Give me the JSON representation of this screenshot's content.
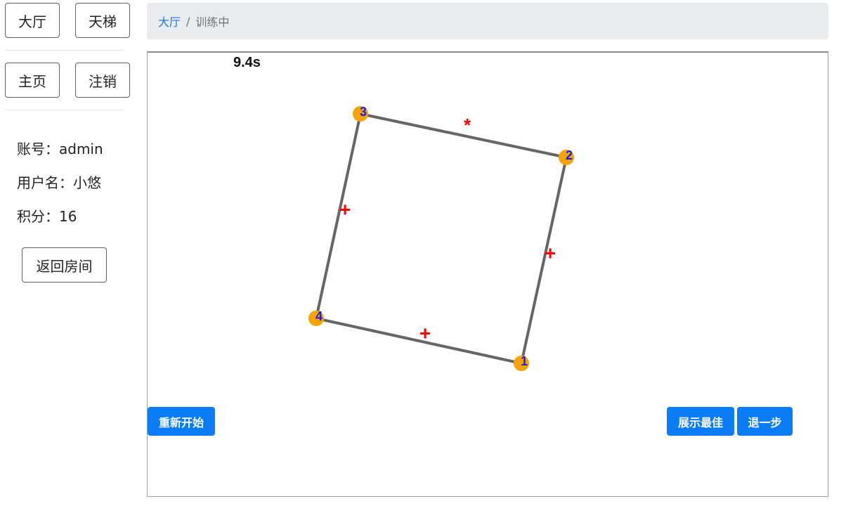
{
  "nav": {
    "lobby_label": "大厅",
    "ladder_label": "天梯",
    "home_label": "主页",
    "logout_label": "注销"
  },
  "user": {
    "account_label": "账号：admin",
    "username_label": "用户名：小悠",
    "score_label": "积分：16"
  },
  "back_room_label": "返回房间",
  "breadcrumb": {
    "lobby": "大厅",
    "separator": "/",
    "current": "训练中"
  },
  "game": {
    "timer": "9.4s",
    "nodes": [
      {
        "label": "1"
      },
      {
        "label": "2"
      },
      {
        "label": "3"
      },
      {
        "label": "4"
      }
    ],
    "edge_ops": [
      "+",
      "*",
      "+",
      "+"
    ],
    "colors": {
      "node": "#f5a300",
      "node_label": "#1a1aff",
      "edge": "#666666",
      "op": "#ff0000"
    },
    "restart_label": "重新开始",
    "show_best_label": "展示最佳",
    "undo_label": "退一步"
  }
}
